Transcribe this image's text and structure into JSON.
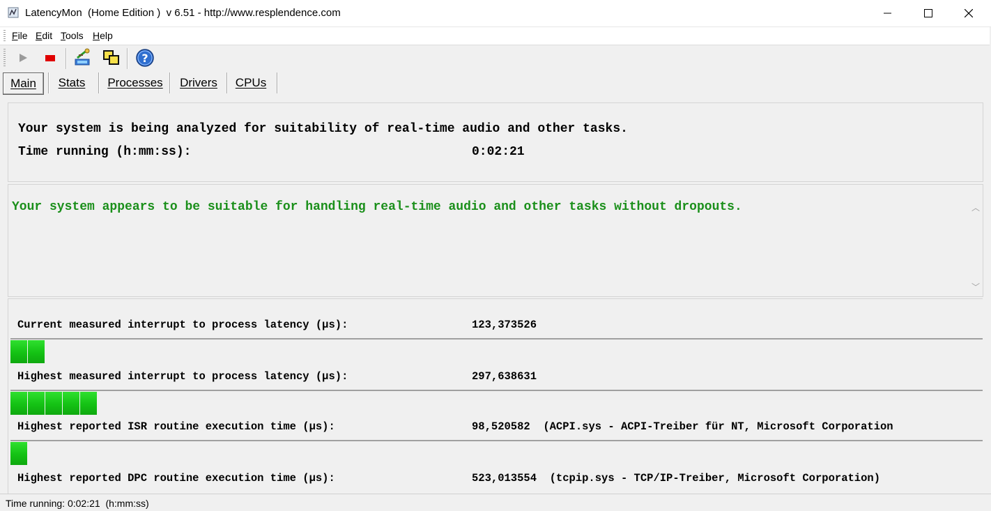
{
  "window": {
    "title": "LatencyMon  (Home Edition )  v 6.51 - http://www.resplendence.com"
  },
  "menu": [
    {
      "label": "File",
      "mnemonic": "F",
      "rest": "ile"
    },
    {
      "label": "Edit",
      "mnemonic": "E",
      "rest": "dit"
    },
    {
      "label": "Tools",
      "mnemonic": "T",
      "rest": "ools"
    },
    {
      "label": "Help",
      "mnemonic": "H",
      "rest": "elp"
    }
  ],
  "toolbar": {
    "icons": [
      "play-icon",
      "stop-icon",
      "analyze-icon",
      "windows-icon",
      "help-icon"
    ]
  },
  "tabs": [
    {
      "label": "Main",
      "active": true
    },
    {
      "label": "Stats",
      "active": false
    },
    {
      "label": "Processes",
      "active": false
    },
    {
      "label": "Drivers",
      "active": false
    },
    {
      "label": "CPUs",
      "active": false
    }
  ],
  "main": {
    "analyzing_text": "Your system is being analyzed for suitability of real-time audio and other tasks.",
    "time_label": "Time running (h:mm:ss):",
    "time_value": "0:02:21",
    "verdict": "Your system appears to be suitable for handling real-time audio and other tasks without dropouts.",
    "verdict_color": "#1a8f1a",
    "metrics": [
      {
        "label": "Current measured interrupt to process latency (µs):",
        "value": "123,373526",
        "detail": "",
        "bar_segments": 2
      },
      {
        "label": "Highest measured interrupt to process latency (µs):",
        "value": "297,638631",
        "detail": "",
        "bar_segments": 5
      },
      {
        "label": "Highest reported ISR routine execution time (µs):",
        "value": "98,520582",
        "detail": "(ACPI.sys - ACPI-Treiber für NT, Microsoft Corporation",
        "bar_segments": 1
      },
      {
        "label": "Highest reported DPC routine execution time (µs):",
        "value": "523,013554",
        "detail": "(tcpip.sys - TCP/IP-Treiber, Microsoft Corporation)",
        "bar_segments": 0
      }
    ]
  },
  "status": {
    "text": "Time running: 0:02:21  (h:mm:ss)"
  },
  "colors": {
    "bar_green": "#14c214",
    "background": "#f0f0f0"
  }
}
